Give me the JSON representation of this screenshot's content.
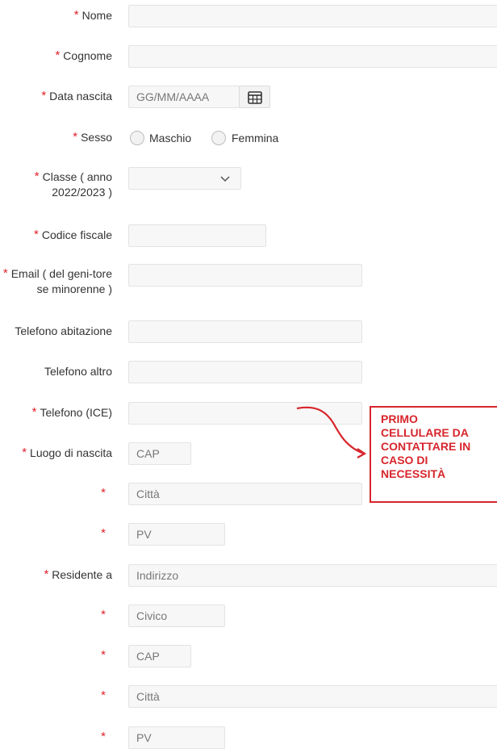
{
  "form": {
    "nome": {
      "label": "Nome",
      "value": ""
    },
    "cognome": {
      "label": "Cognome",
      "value": ""
    },
    "data_nascita": {
      "label": "Data nascita",
      "placeholder": "GG/MM/AAAA"
    },
    "sesso": {
      "label": "Sesso",
      "options": [
        "Maschio",
        "Femmina"
      ]
    },
    "classe": {
      "label": "Classe ( anno 2022/2023 )",
      "value": ""
    },
    "codice_fiscale": {
      "label": "Codice fiscale",
      "value": ""
    },
    "email": {
      "label": "Email ( del geni-tore se minorenne )",
      "value": ""
    },
    "telefono_abitazione": {
      "label": "Telefono abitazione",
      "value": ""
    },
    "telefono_altro": {
      "label": "Telefono altro",
      "value": ""
    },
    "telefono_ice": {
      "label": "Telefono (ICE)",
      "value": ""
    },
    "luogo_nascita": {
      "label": "Luogo di nascita",
      "cap_placeholder": "CAP",
      "citta_placeholder": "Città",
      "pv_placeholder": "PV"
    },
    "residente": {
      "label": "Residente a",
      "indirizzo_placeholder": "Indirizzo",
      "civico_placeholder": "Civico",
      "cap_placeholder": "CAP",
      "citta_placeholder": "Città",
      "pv_placeholder": "PV"
    }
  },
  "required_marker": "*",
  "annotation": {
    "text": "PRIMO CELLULARE DA CONTATTARE IN CASO DI NECESSITÀ",
    "color": "#d7262c"
  },
  "icons": {
    "calendar": "calendar-icon",
    "dropdown": "chevron-down-icon",
    "arrow": "curved-arrow-icon"
  }
}
